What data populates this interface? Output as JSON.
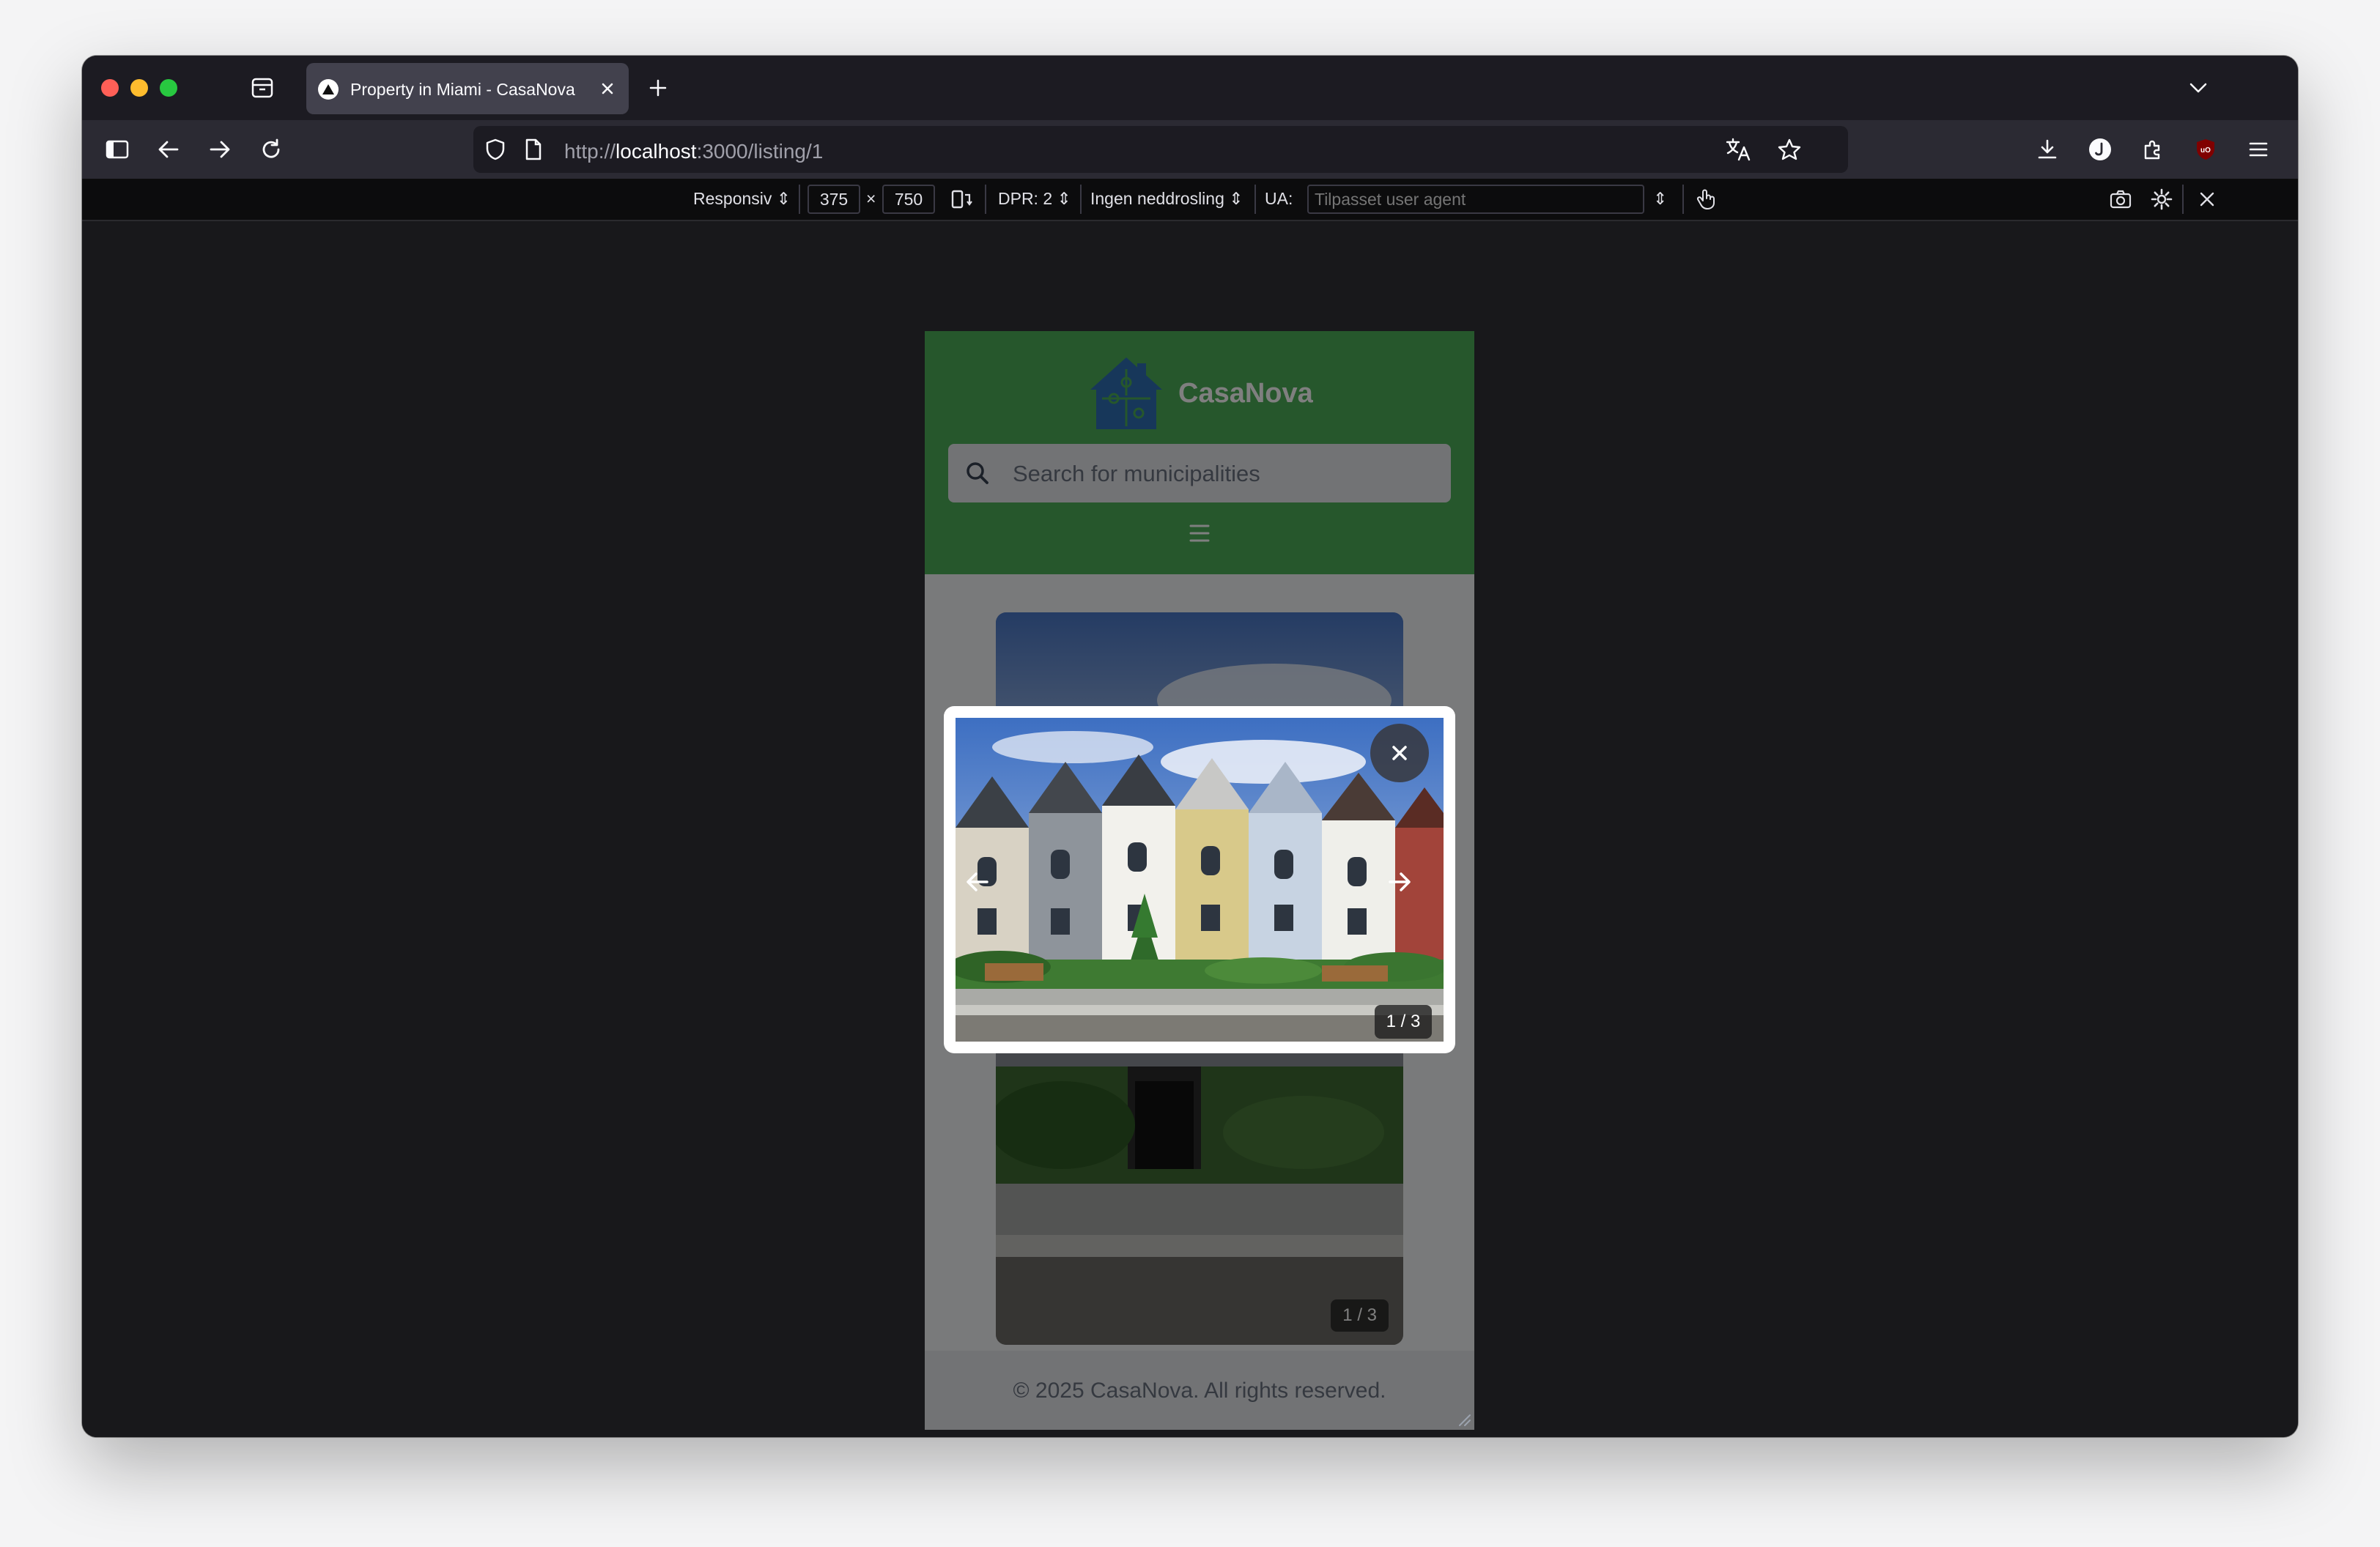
{
  "browser": {
    "tab_title": "Property in Miami - CasaNova",
    "url_scheme": "http://",
    "url_host": "localhost",
    "url_path": ":3000/listing/1"
  },
  "devtools": {
    "device_mode": "Responsiv",
    "width": "375",
    "height": "750",
    "times": "×",
    "dpr": "DPR: 2",
    "throttling": "Ingen neddrosling",
    "ua_label": "UA:",
    "ua_placeholder": "Tilpasset user agent"
  },
  "site": {
    "brand": "CasaNova",
    "search_placeholder": "Search for municipalities",
    "footer": "© 2025 CasaNova. All rights reserved.",
    "background_counter": "1 / 3"
  },
  "lightbox": {
    "counter": "1 / 3"
  },
  "colors": {
    "header_green": "#4caf58",
    "logo_blue": "#2f6fb4"
  },
  "icons": [
    "tab-overview-icon",
    "sidebar-icon",
    "back-icon",
    "forward-icon",
    "reload-icon",
    "shield-icon",
    "page-icon",
    "translate-icon",
    "bookmark-star-icon",
    "download-icon",
    "profile-icon",
    "extensions-icon",
    "ublock-icon",
    "menu-icon",
    "rotate-icon",
    "touch-icon",
    "screenshot-icon",
    "settings-icon",
    "close-icon",
    "search-icon",
    "hamburger-icon",
    "arrow-left-icon",
    "arrow-right-icon"
  ]
}
